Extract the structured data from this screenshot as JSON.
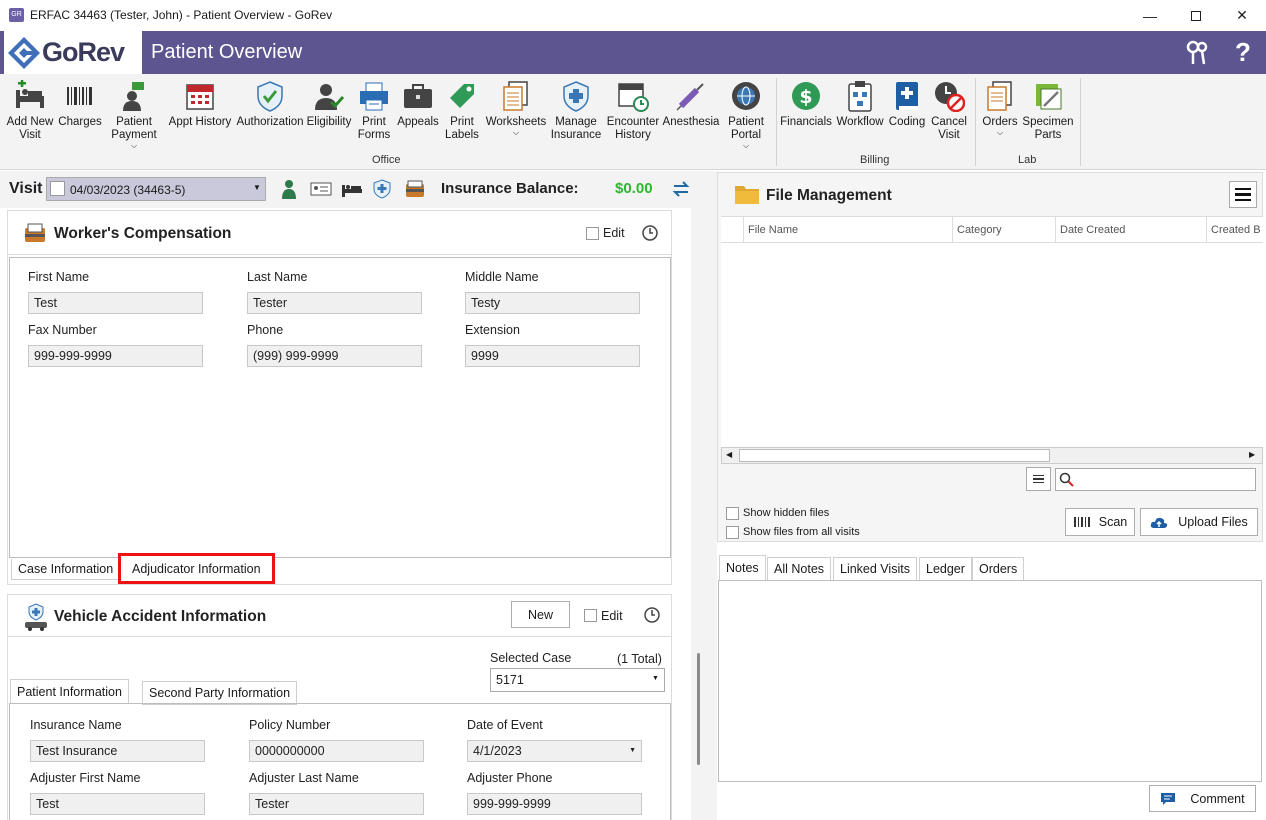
{
  "window": {
    "title": "ERFAC 34463 (Tester, John) - Patient Overview - GoRev",
    "app_icon_text": "GR"
  },
  "header": {
    "logo_text": "GoRev",
    "title": "Patient Overview"
  },
  "toolbar": {
    "items": [
      {
        "label": "Add New Visit",
        "icon": "bed-add-icon"
      },
      {
        "label": "Charges",
        "icon": "barcode-icon"
      },
      {
        "label": "Patient Payment",
        "icon": "money-hand-icon"
      },
      {
        "label": "Appt History",
        "icon": "calendar-icon"
      },
      {
        "label": "Authorization",
        "icon": "shield-check-icon"
      },
      {
        "label": "Eligibility",
        "icon": "user-check-icon"
      },
      {
        "label": "Print Forms",
        "icon": "printer-icon"
      },
      {
        "label": "Appeals",
        "icon": "briefcase-icon"
      },
      {
        "label": "Print Labels",
        "icon": "label-tag-icon"
      },
      {
        "label": "Worksheets",
        "icon": "documents-icon"
      },
      {
        "label": "Manage Insurance",
        "icon": "insurance-shield-icon"
      },
      {
        "label": "Encounter History",
        "icon": "calendar-clock-icon"
      },
      {
        "label": "Anesthesia",
        "icon": "syringe-icon"
      },
      {
        "label": "Patient Portal",
        "icon": "globe-gear-icon"
      },
      {
        "label": "Financials",
        "icon": "dollar-icon"
      },
      {
        "label": "Workflow",
        "icon": "clipboard-workflow-icon"
      },
      {
        "label": "Coding",
        "icon": "medical-book-icon"
      },
      {
        "label": "Cancel Visit",
        "icon": "cancel-clock-icon"
      },
      {
        "label": "Orders",
        "icon": "orders-documents-icon"
      },
      {
        "label": "Specimen Parts",
        "icon": "specimen-icon"
      }
    ],
    "groups": {
      "office": "Office",
      "billing": "Billing",
      "lab": "Lab"
    }
  },
  "visit": {
    "label": "Visit",
    "selected": "04/03/2023 (34463-5)",
    "balance_label": "Insurance Balance:",
    "balance_value": "$0.00",
    "balance_color": "#2db92d"
  },
  "workers_comp": {
    "title": "Worker's Compensation",
    "edit_label": "Edit",
    "fields": {
      "first_name_label": "First Name",
      "first_name": "Test",
      "last_name_label": "Last Name",
      "last_name": "Tester",
      "middle_name_label": "Middle Name",
      "middle_name": "Testy",
      "fax_label": "Fax Number",
      "fax": "999-999-9999",
      "phone_label": "Phone",
      "phone": "(999) 999-9999",
      "extension_label": "Extension",
      "extension": "9999"
    },
    "tabs": {
      "case_info": "Case Information",
      "adjudicator_info": "Adjudicator Information"
    }
  },
  "vehicle": {
    "title": "Vehicle Accident Information",
    "new_label": "New",
    "edit_label": "Edit",
    "selected_case_label": "Selected Case",
    "total": "(1 Total)",
    "selected_case": "5171",
    "tabs": {
      "patient_info": "Patient Information",
      "second_party": "Second Party Information"
    },
    "fields": {
      "insurance_name_label": "Insurance Name",
      "insurance_name": "Test Insurance",
      "policy_number_label": "Policy Number",
      "policy_number": "0000000000",
      "date_of_event_label": "Date of Event",
      "date_of_event": "4/1/2023",
      "adj_first_label": "Adjuster First Name",
      "adj_first": "Test",
      "adj_last_label": "Adjuster Last Name",
      "adj_last": "Tester",
      "adj_phone_label": "Adjuster Phone",
      "adj_phone": "999-999-9999"
    }
  },
  "file_mgmt": {
    "title": "File Management",
    "columns": [
      "File Name",
      "Category",
      "Date Created",
      "Created B"
    ],
    "show_hidden": "Show hidden files",
    "show_all_visits": "Show files from all visits",
    "scan_label": "Scan",
    "upload_label": "Upload Files"
  },
  "notes": {
    "tabs": [
      "Notes",
      "All Notes",
      "Linked Visits",
      "Ledger",
      "Orders"
    ],
    "comment_label": "Comment"
  },
  "colors": {
    "header_bg": "#5d5590",
    "accent_red": "#e11"
  }
}
